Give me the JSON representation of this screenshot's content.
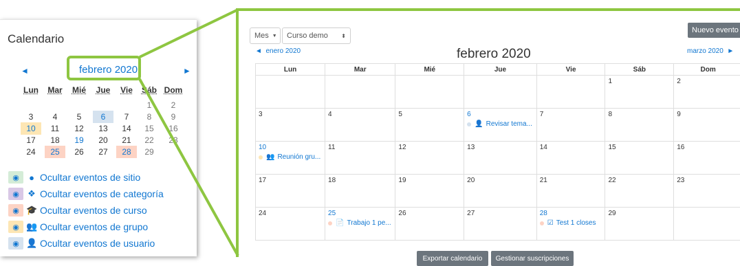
{
  "mini": {
    "title": "Calendario",
    "prev_arrow": "◄",
    "next_arrow": "►",
    "month": "febrero 2020",
    "weekdays": [
      "Lun",
      "Mar",
      "Mié",
      "Jue",
      "Vie",
      "Sáb",
      "Dom"
    ],
    "weeks": [
      [
        "",
        "",
        "",
        "",
        "",
        "1",
        "2"
      ],
      [
        "3",
        "4",
        "5",
        "6",
        "7",
        "8",
        "9"
      ],
      [
        "10",
        "11",
        "12",
        "13",
        "14",
        "15",
        "16"
      ],
      [
        "17",
        "18",
        "19",
        "20",
        "21",
        "22",
        "23"
      ],
      [
        "24",
        "25",
        "26",
        "27",
        "28",
        "29",
        ""
      ]
    ],
    "legend": [
      {
        "label": "Ocultar eventos de sitio",
        "icon": "globe-icon",
        "color": "#d4ecd7"
      },
      {
        "label": "Ocultar eventos de categoría",
        "icon": "cubes-icon",
        "color": "#d9c8e6"
      },
      {
        "label": "Ocultar eventos de curso",
        "icon": "graduation-cap-icon",
        "color": "#fdd3c4"
      },
      {
        "label": "Ocultar eventos de grupo",
        "icon": "users-icon",
        "color": "#fde6b4"
      },
      {
        "label": "Ocultar eventos de usuario",
        "icon": "user-icon",
        "color": "#d5e2ef"
      }
    ]
  },
  "main": {
    "view_select": "Mes",
    "course_select": "Curso demo",
    "new_event": "Nuevo evento",
    "prev_month": "enero 2020",
    "next_month": "marzo 2020",
    "month": "febrero 2020",
    "weekdays": [
      "Lun",
      "Mar",
      "Mié",
      "Jue",
      "Vie",
      "Sáb",
      "Dom"
    ],
    "weeks": [
      [
        {
          "d": ""
        },
        {
          "d": ""
        },
        {
          "d": ""
        },
        {
          "d": ""
        },
        {
          "d": ""
        },
        {
          "d": "1"
        },
        {
          "d": "2"
        }
      ],
      [
        {
          "d": "3"
        },
        {
          "d": "4"
        },
        {
          "d": "5"
        },
        {
          "d": "6",
          "link": true,
          "event": "Revisar tema...",
          "icon": "user-icon",
          "dot": "#d5e2ef"
        },
        {
          "d": "7"
        },
        {
          "d": "8"
        },
        {
          "d": "9"
        }
      ],
      [
        {
          "d": "10",
          "link": true,
          "event": "Reunión gru...",
          "icon": "users-icon",
          "dot": "#fde6b4"
        },
        {
          "d": "11"
        },
        {
          "d": "12"
        },
        {
          "d": "13"
        },
        {
          "d": "14"
        },
        {
          "d": "15"
        },
        {
          "d": "16"
        }
      ],
      [
        {
          "d": "17"
        },
        {
          "d": "18"
        },
        {
          "d": "19"
        },
        {
          "d": "20"
        },
        {
          "d": "21"
        },
        {
          "d": "22"
        },
        {
          "d": "23"
        }
      ],
      [
        {
          "d": "24"
        },
        {
          "d": "25",
          "link": true,
          "event": "Trabajo 1 pe...",
          "icon": "assignment-icon",
          "dot": "#fdd3c4"
        },
        {
          "d": "26"
        },
        {
          "d": "27"
        },
        {
          "d": "28",
          "link": true,
          "event": "Test 1 closes",
          "icon": "quiz-icon",
          "dot": "#fdd3c4"
        },
        {
          "d": "29"
        },
        {
          "d": ""
        }
      ]
    ],
    "export_button": "Exportar calendario",
    "subscriptions_button": "Gestionar suscripciones"
  },
  "colors": {
    "accent_green": "#8ec641",
    "link": "#1177d1",
    "button": "#6c757d"
  }
}
